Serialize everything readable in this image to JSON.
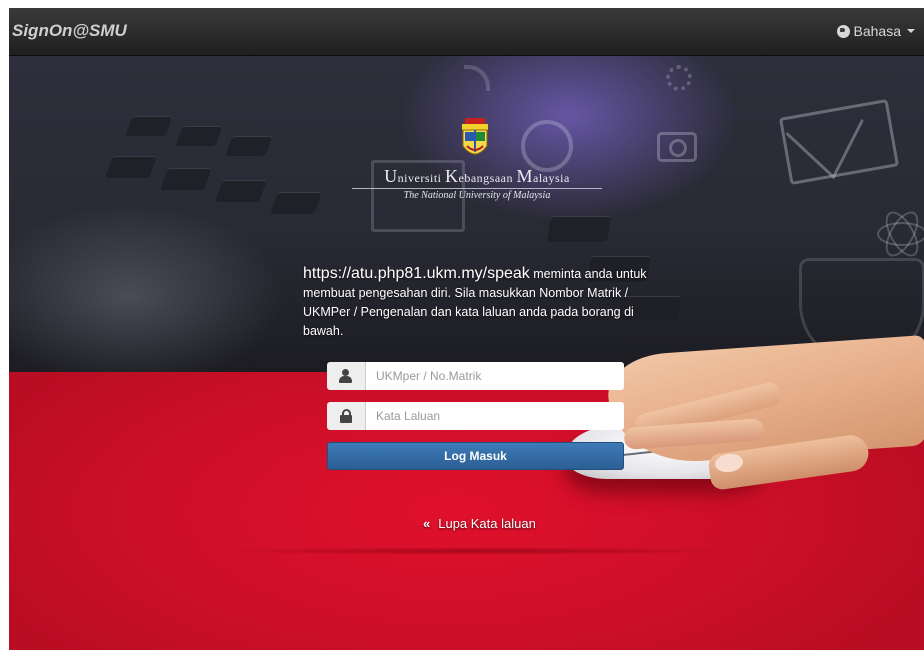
{
  "navbar": {
    "brand": "SignOn@SMU",
    "language_label": "Bahasa"
  },
  "branding": {
    "university_name_parts": [
      "U",
      "niversiti ",
      "K",
      "ebangsaan ",
      "M",
      "alaysia"
    ],
    "university_tagline": "The National University of Malaysia"
  },
  "message": {
    "url": "https://atu.php81.ukm.my/speak",
    "text": " meminta anda untuk membuat pengesahan diri. Sila masukkan Nombor Matrik / UKMPer / Pengenalan dan kata laluan anda pada borang di bawah."
  },
  "form": {
    "username": {
      "placeholder": "UKMper / No.Matrik",
      "value": ""
    },
    "password": {
      "placeholder": "Kata Laluan",
      "value": ""
    },
    "submit_label": "Log Masuk"
  },
  "links": {
    "forgot_icon": "«",
    "forgot_label": "Lupa Kata laluan"
  },
  "icons": {
    "username": "user-icon",
    "password": "lock-icon",
    "language": "globe-icon"
  },
  "colors": {
    "navbar": "#2b2b2b",
    "background_red": "#d0102a",
    "button_blue": "#3366a0"
  }
}
